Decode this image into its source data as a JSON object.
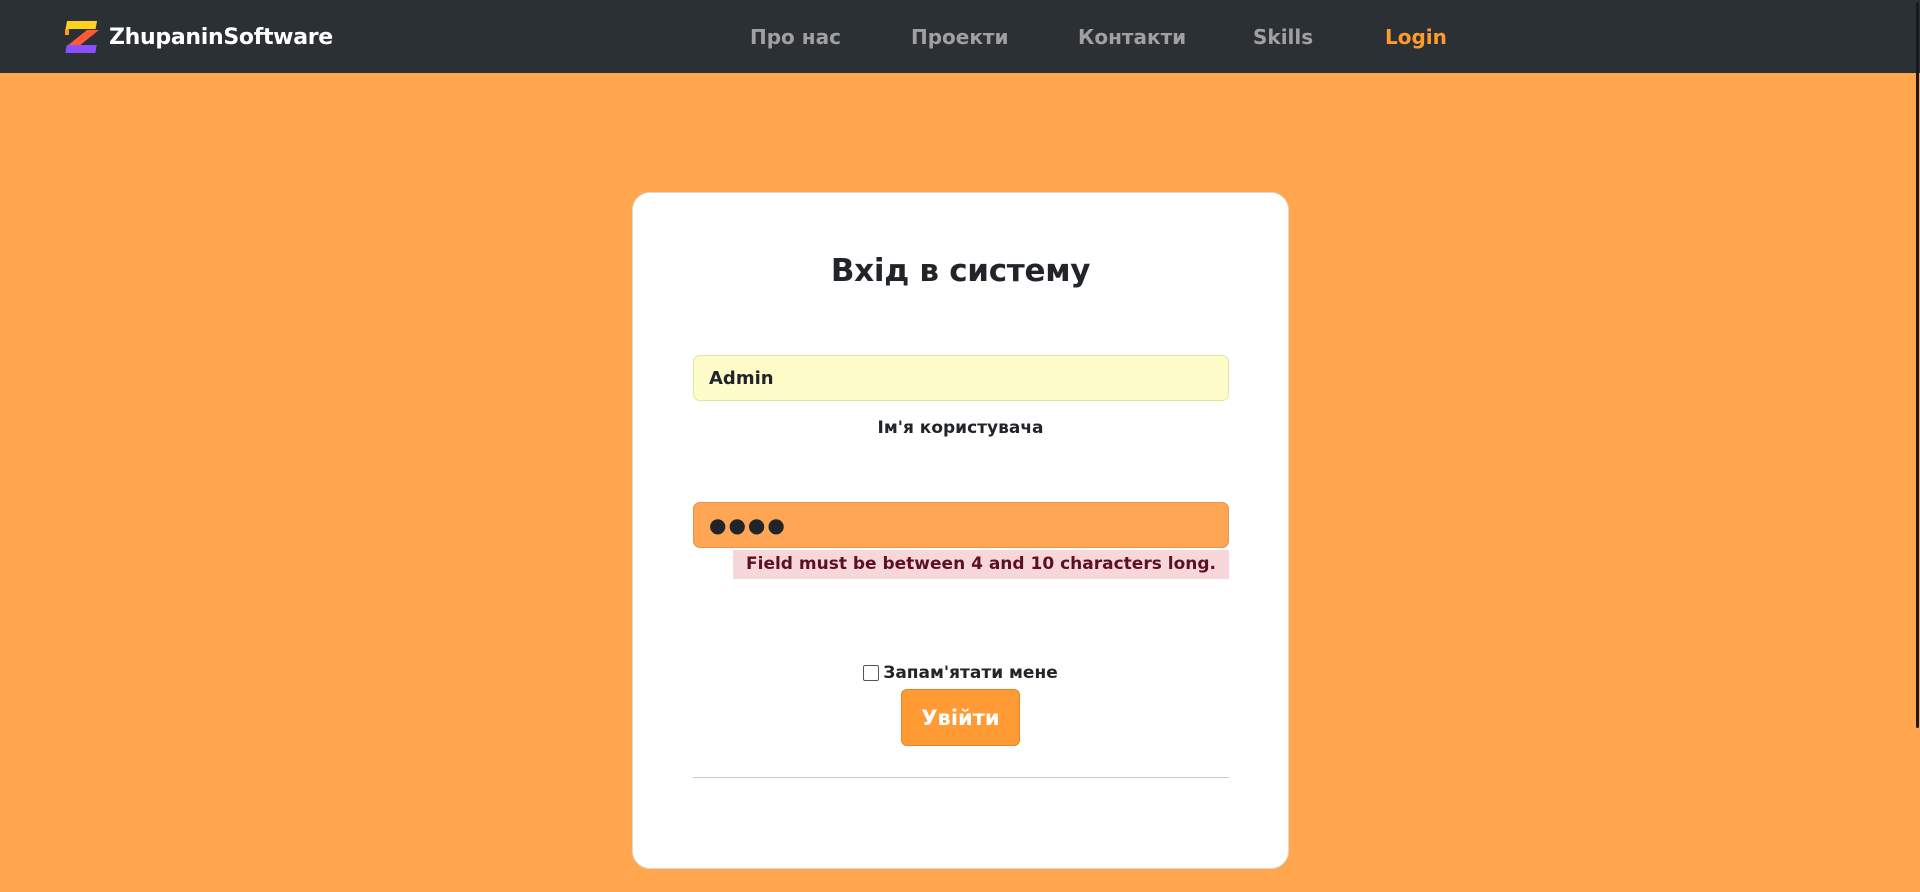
{
  "navbar": {
    "brand": "ZhupaninSoftware",
    "links": [
      "Про нас",
      "Проекти",
      "Контакти",
      "Skills",
      "Login"
    ],
    "active_color": "#ff9a2e",
    "background": "#2b3035"
  },
  "login_form": {
    "title": "Вхід в систему",
    "username_value": "Admin",
    "username_label": "Ім'я користувача",
    "password_value": "●●●●",
    "password_error": "Field must be between 4 and 10 characters long.",
    "remember_label": "Запам'ятати мене",
    "remember_checked": false,
    "submit_label": "Увійти"
  },
  "colors": {
    "page_background": "#ffa64f",
    "accent": "#ff9a34",
    "error_background": "#f8d7da",
    "username_fill": "#fefdc9"
  }
}
